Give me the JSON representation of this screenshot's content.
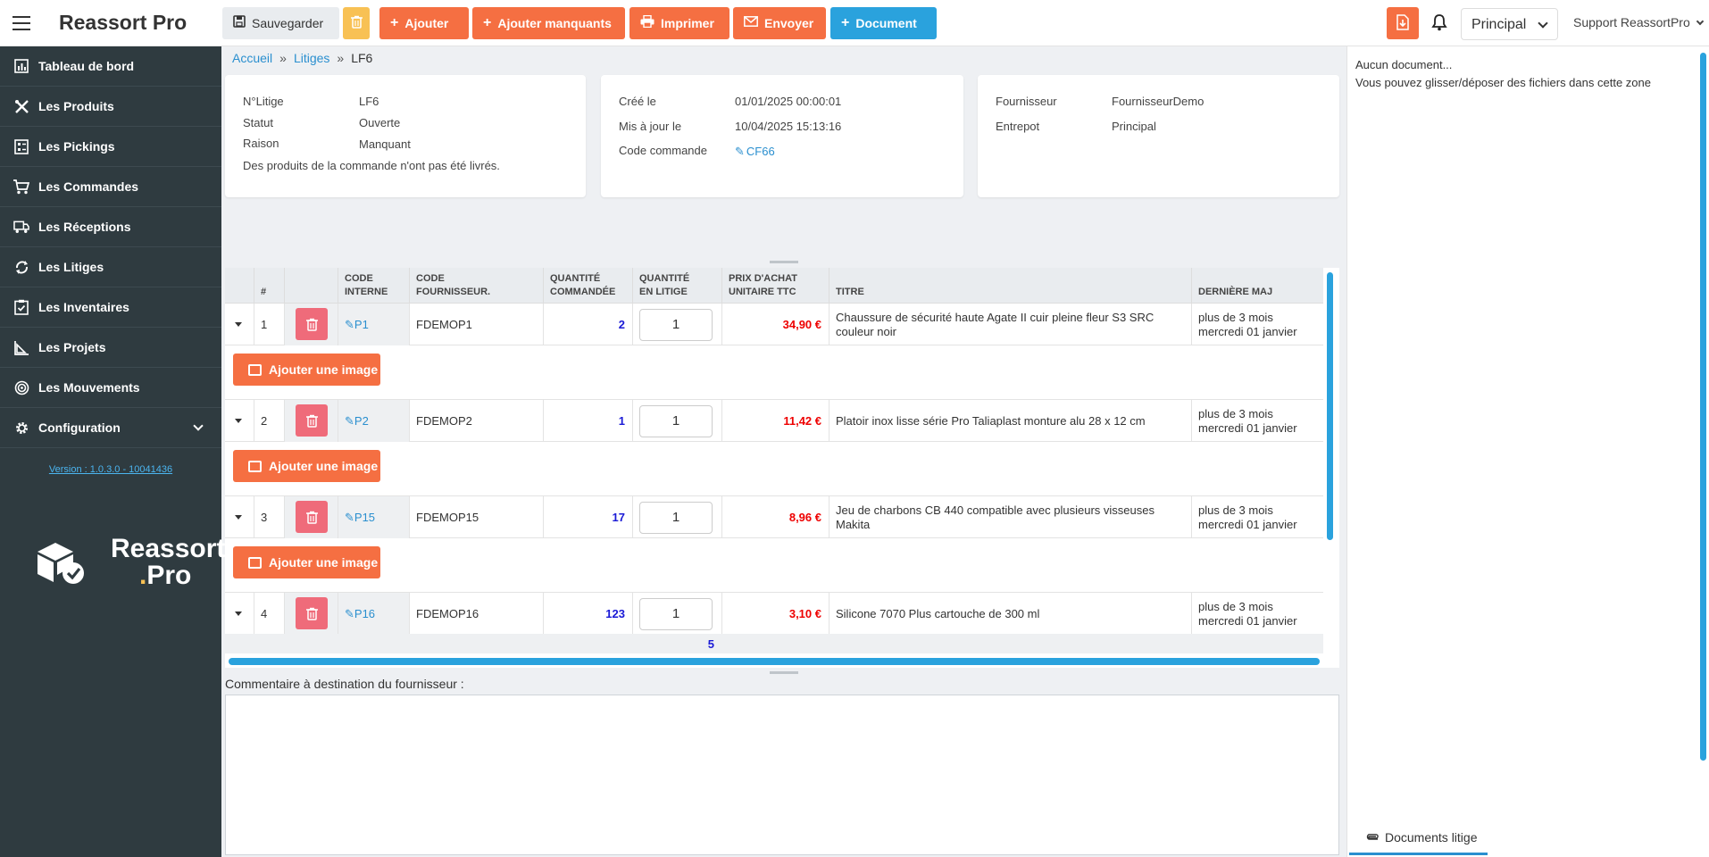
{
  "topbar": {
    "brand": "Reassort Pro",
    "save": "Sauvegarder",
    "add": "Ajouter",
    "add_missing": "Ajouter manquants",
    "print": "Imprimer",
    "send": "Envoyer",
    "document": "Document",
    "warehouse_select": "Principal",
    "user": "Support ReassortPro"
  },
  "sidebar": {
    "items": [
      {
        "label": "Tableau de bord",
        "icon": "dashboard-icon"
      },
      {
        "label": "Les Produits",
        "icon": "tools-icon"
      },
      {
        "label": "Les Pickings",
        "icon": "picking-icon"
      },
      {
        "label": "Les Commandes",
        "icon": "cart-icon"
      },
      {
        "label": "Les Réceptions",
        "icon": "truck-icon"
      },
      {
        "label": "Les Litiges",
        "icon": "dispute-icon"
      },
      {
        "label": "Les Inventaires",
        "icon": "clipboard-icon"
      },
      {
        "label": "Les Projets",
        "icon": "project-icon"
      },
      {
        "label": "Les Mouvements",
        "icon": "movement-icon"
      },
      {
        "label": "Configuration",
        "icon": "gear-icon"
      }
    ],
    "version": "Version : 1.0.3.0 - 10041436",
    "logo_line1": "Reassort",
    "logo_dot": ".",
    "logo_line2": "Pro"
  },
  "breadcrumb": {
    "home": "Accueil",
    "section": "Litiges",
    "current": "LF6",
    "separator": "»"
  },
  "card1": {
    "litige_label": "N°Litige",
    "litige_value": "LF6",
    "status_label": "Statut",
    "status_value": "Ouverte",
    "reason_label": "Raison",
    "reason_value": "Manquant",
    "description": "Des produits de la commande n'ont pas été livrés."
  },
  "card2": {
    "created_label": "Créé le",
    "created_value": "01/01/2025 00:00:01",
    "updated_label": "Mis à jour le",
    "updated_value": "10/04/2025 15:13:16",
    "order_label": "Code commande",
    "order_value": "CF66"
  },
  "card3": {
    "supplier_label": "Fournisseur",
    "supplier_value": "FournisseurDemo",
    "warehouse_label": "Entrepot",
    "warehouse_value": "Principal"
  },
  "table": {
    "headers": {
      "index": "#",
      "internal_code_1": "CODE",
      "internal_code_2": "INTERNE",
      "supplier_code_1": "CODE",
      "supplier_code_2": "FOURNISSEUR.",
      "ordered_1": "QUANTITÉ",
      "ordered_2": "COMMANDÉE",
      "disputed_1": "QUANTITÉ",
      "disputed_2": "EN LITIGE",
      "price_1": "PRIX D'ACHAT",
      "price_2": "UNITAIRE TTC",
      "title": "TITRE",
      "updated": "DERNIÈRE MAJ"
    },
    "rows": [
      {
        "index": "1",
        "code": "P1",
        "supplier_code": "FDEMOP1",
        "ordered": "2",
        "disputed": "1",
        "price": "34,90 €",
        "title": "Chaussure de sécurité haute Agate II cuir pleine fleur S3 SRC couleur noir",
        "updated_1": "plus de 3 mois",
        "updated_2": "mercredi 01 janvier"
      },
      {
        "index": "2",
        "code": "P2",
        "supplier_code": "FDEMOP2",
        "ordered": "1",
        "disputed": "1",
        "price": "11,42 €",
        "title": "Platoir inox lisse série Pro Taliaplast monture alu 28 x 12 cm",
        "updated_1": "plus de 3 mois",
        "updated_2": "mercredi 01 janvier"
      },
      {
        "index": "3",
        "code": "P15",
        "supplier_code": "FDEMOP15",
        "ordered": "17",
        "disputed": "1",
        "price": "8,96 €",
        "title": "Jeu de charbons CB 440 compatible avec plusieurs visseuses Makita",
        "updated_1": "plus de 3 mois",
        "updated_2": "mercredi 01 janvier"
      },
      {
        "index": "4",
        "code": "P16",
        "supplier_code": "FDEMOP16",
        "ordered": "123",
        "disputed": "1",
        "price": "3,10 €",
        "title": "Silicone 7070 Plus cartouche de 300 ml",
        "updated_1": "plus de 3 mois",
        "updated_2": "mercredi 01 janvier"
      }
    ],
    "add_image": "Ajouter une image",
    "total_disputed": "5"
  },
  "comment": {
    "label": "Commentaire à destination du fournisseur :",
    "value": ""
  },
  "documents": {
    "empty": "Aucun document...",
    "hint": "Vous pouvez glisser/déposer des fichiers dans cette zone",
    "tab": "Documents litige"
  },
  "colors": {
    "sidebar": "#2f3b40",
    "orange": "#f56f42",
    "blue": "#2aa2dd",
    "yellow": "#f8c154",
    "red": "#ef6b7a"
  }
}
